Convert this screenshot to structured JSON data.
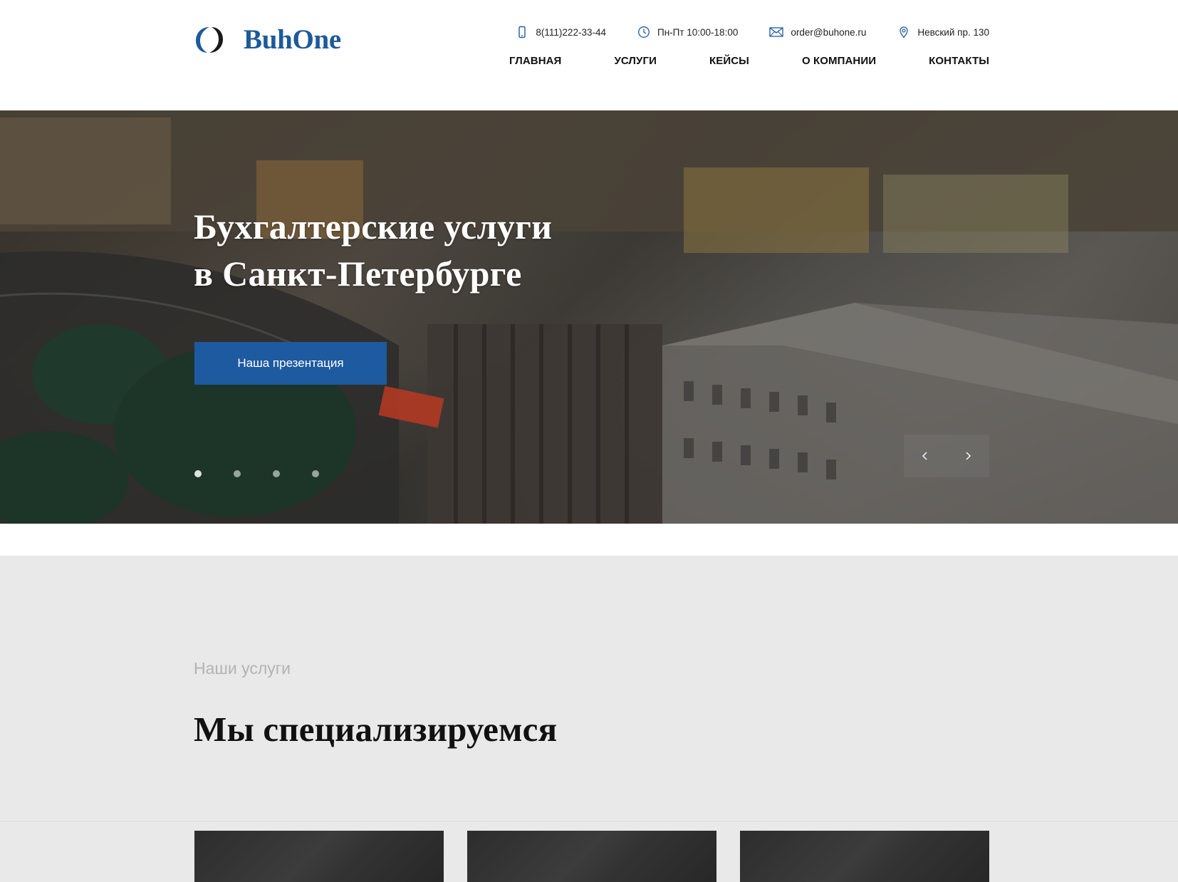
{
  "brand": {
    "name": "BuhOne",
    "accent_color": "#1e5aa0",
    "logo_icon": "ring-logo-icon"
  },
  "contacts": {
    "phone": {
      "icon": "phone-icon",
      "text": "8(111)222-33-44"
    },
    "hours": {
      "icon": "clock-icon",
      "text": "Пн-Пт 10:00-18:00"
    },
    "email": {
      "icon": "envelope-icon",
      "text": "order@buhone.ru"
    },
    "address": {
      "icon": "map-pin-icon",
      "text": "Невский пр. 130"
    }
  },
  "nav": {
    "items": [
      {
        "label": "ГЛАВНАЯ"
      },
      {
        "label": "УСЛУГИ"
      },
      {
        "label": "КЕЙСЫ"
      },
      {
        "label": "О КОМПАНИИ"
      },
      {
        "label": "КОНТАКТЫ"
      }
    ]
  },
  "hero": {
    "title_line1": "Бухгалтерские услуги",
    "title_line2": "в Санкт-Петербурге",
    "button_label": "Наша презентация",
    "slide_count": 4,
    "active_slide": 1,
    "prev_icon": "chevron-left-icon",
    "next_icon": "chevron-right-icon"
  },
  "services": {
    "eyebrow": "Наши услуги",
    "title": "Мы специализируемся",
    "card_count": 3
  }
}
